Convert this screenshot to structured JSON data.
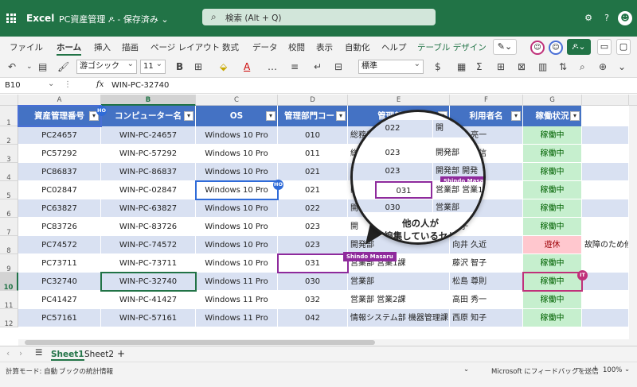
{
  "app": {
    "name": "Excel",
    "doc_title": "PC資産管理",
    "doc_status": "保存済み",
    "search_placeholder": "検索 (Alt + Q)"
  },
  "ribbon": {
    "tabs": [
      {
        "label": "ファイル"
      },
      {
        "label": "ホーム"
      },
      {
        "label": "挿入"
      },
      {
        "label": "描画"
      },
      {
        "label": "ページ レイアウト"
      },
      {
        "label": "数式"
      },
      {
        "label": "データ"
      },
      {
        "label": "校閲"
      },
      {
        "label": "表示"
      },
      {
        "label": "自動化"
      },
      {
        "label": "ヘルプ"
      },
      {
        "label": "テーブル デザイン"
      }
    ],
    "active_tab": "ホーム",
    "font_name": "游ゴシック",
    "font_size": "11",
    "number_format": "標準"
  },
  "formula_bar": {
    "name_box": "B10",
    "fx": "fx",
    "value": "WIN-PC-32740"
  },
  "columns": [
    "A",
    "B",
    "C",
    "D",
    "E",
    "F",
    "G"
  ],
  "rows": [
    "1",
    "2",
    "3",
    "4",
    "5",
    "6",
    "7",
    "8",
    "9",
    "10",
    "11",
    "12"
  ],
  "table": {
    "headers": [
      "資産管理番号",
      "コンピューター名",
      "OS",
      "管理部門コード",
      "管理部門名",
      "利用者名",
      "稼働状況"
    ],
    "rows": [
      [
        "PC24657",
        "WIN-PC-24657",
        "Windows 10 Pro",
        "010",
        "総務部",
        "山田 亮一",
        "稼働中"
      ],
      [
        "PC57292",
        "WIN-PC-57292",
        "Windows 10 Pro",
        "011",
        "総務",
        "伊藤 元信",
        "稼働中"
      ],
      [
        "PC86837",
        "WIN-PC-86837",
        "Windows 10 Pro",
        "021",
        "開",
        "人",
        "稼働中"
      ],
      [
        "PC02847",
        "WIN-PC-02847",
        "Windows 10 Pro",
        "021",
        "開",
        "代",
        "稼働中"
      ],
      [
        "PC63827",
        "WIN-PC-63827",
        "Windows 10 Pro",
        "022",
        "開",
        "",
        "稼働中"
      ],
      [
        "PC83726",
        "WIN-PC-83726",
        "Windows 10 Pro",
        "023",
        "開",
        "知子",
        "稼働中"
      ],
      [
        "PC74572",
        "WIN-PC-74572",
        "Windows 10 Pro",
        "023",
        "開発部",
        "向井 久近",
        "遊休"
      ],
      [
        "PC73711",
        "WIN-PC-73711",
        "Windows 10 Pro",
        "031",
        "営業部 営業1課",
        "藤沢 智子",
        "稼働中"
      ],
      [
        "PC32740",
        "WIN-PC-32740",
        "Windows 11 Pro",
        "030",
        "営業部",
        "松島 尊則",
        "稼働中"
      ],
      [
        "PC41427",
        "WIN-PC-41427",
        "Windows 11 Pro",
        "032",
        "営業部 営業2課",
        "高田 秀一",
        "稼働中"
      ],
      [
        "PC57161",
        "WIN-PC-57161",
        "Windows 11 Pro",
        "042",
        "情報システム部 機器管理課",
        "西原 知子",
        "稼働中"
      ]
    ],
    "overflow_note": "故障のため修"
  },
  "presence": {
    "ho": "HO",
    "it": "IT",
    "shindo_label": "Shindo Masaru"
  },
  "bubble": {
    "cells": [
      [
        "022",
        "開"
      ],
      [
        "023",
        "開発部"
      ],
      [
        "023",
        "開発部 開発"
      ],
      [
        "031",
        "営業部 営業1"
      ],
      [
        "030",
        "営業部"
      ]
    ],
    "caption_line1": "他の人が",
    "caption_line2": "編集しているセル"
  },
  "sheets": [
    "Sheet1",
    "Sheet2"
  ],
  "status": {
    "calc_mode": "計算モード: 自動",
    "workbook_stats": "ブックの統計情報",
    "feedback": "Microsoft にフィードバックを送信",
    "zoom": "100%"
  },
  "colors": {
    "brand": "#217346",
    "header": "#4472c4",
    "band": "#d9e1f2",
    "active_status": "#c6efce",
    "idle_status": "#ffc7ce",
    "presence_purple": "#8e2a9c"
  }
}
